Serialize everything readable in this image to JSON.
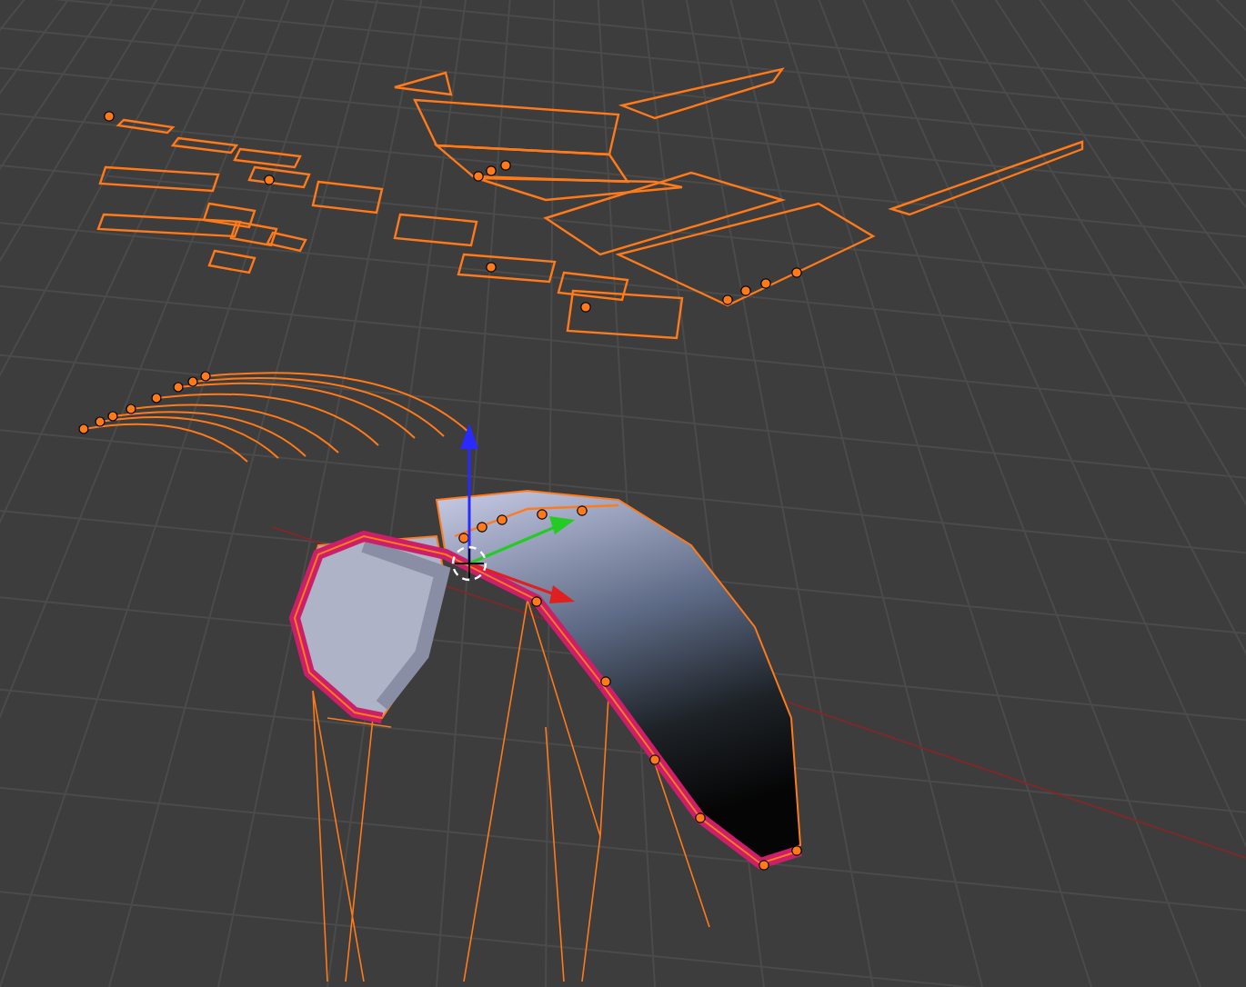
{
  "viewport": {
    "grid": true,
    "x_axis_line": true,
    "manipulator": true,
    "objects": [
      {
        "kind": "flat-panels",
        "selected": true
      },
      {
        "kind": "strips",
        "selected": true
      },
      {
        "kind": "kite",
        "selected": true
      }
    ]
  }
}
